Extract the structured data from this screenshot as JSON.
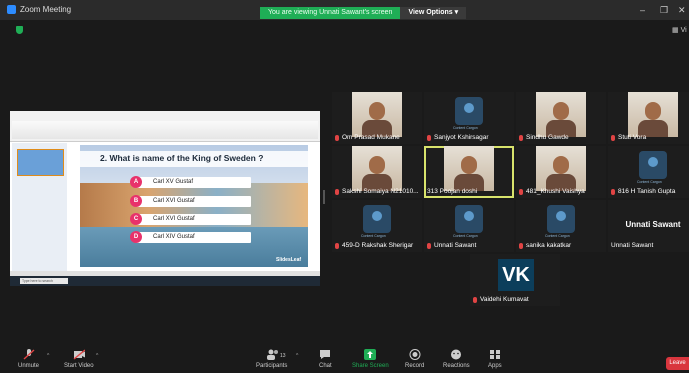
{
  "window": {
    "title": "Zoom Meeting"
  },
  "banner": {
    "viewing_text": "You are viewing Unnati Sawant's screen",
    "view_options": "View Options ▾"
  },
  "window_controls": {
    "minimize": "–",
    "maximize": "❐",
    "close": "✕"
  },
  "top_right": {
    "view": "Vi"
  },
  "shared_screen": {
    "question": "2. What is name of the King of Sweden ?",
    "options": [
      {
        "letter": "A",
        "text": "Carl XV Gustaf"
      },
      {
        "letter": "B",
        "text": "Carl XVI Gustaf"
      },
      {
        "letter": "C",
        "text": "Carl XVI Gustaf"
      },
      {
        "letter": "D",
        "text": "Carl XIV Gustaf"
      }
    ],
    "brand": "SlidesLeaf",
    "search_placeholder": "Type here to search"
  },
  "participants": [
    {
      "name": "Om Prasad Mukane",
      "type": "video"
    },
    {
      "name": "Sanjyot Kshirsagar",
      "type": "avatar"
    },
    {
      "name": "Sindhu Gawde",
      "type": "video"
    },
    {
      "name": "Stuti Vora",
      "type": "video"
    },
    {
      "name": "Sakshi Somaiya N21010...",
      "type": "video"
    },
    {
      "name": "313 Poojan doshi",
      "type": "video",
      "active": true
    },
    {
      "name": "481_Khushi Vaishya",
      "type": "video"
    },
    {
      "name": "816 H Tanish Gupta",
      "type": "avatar"
    },
    {
      "name": "459-D Rakshak Sherigar",
      "type": "avatar"
    },
    {
      "name": "Unnati Sawant",
      "type": "avatar"
    },
    {
      "name": "sanika kakatkar",
      "type": "avatar"
    },
    {
      "name": "Unnati Sawant",
      "type": "name_only",
      "display": "Unnati Sawant"
    },
    {
      "name": "Vaidehi Kumavat",
      "type": "initials",
      "initials": "VK"
    }
  ],
  "avatar_label": "Content Cargon",
  "controls": {
    "unmute": "Unmute",
    "start_video": "Start Video",
    "participants": "Participants",
    "participant_count": "13",
    "chat": "Chat",
    "share_screen": "Share Screen",
    "record": "Record",
    "reactions": "Reactions",
    "apps": "Apps",
    "leave": "Leave"
  }
}
